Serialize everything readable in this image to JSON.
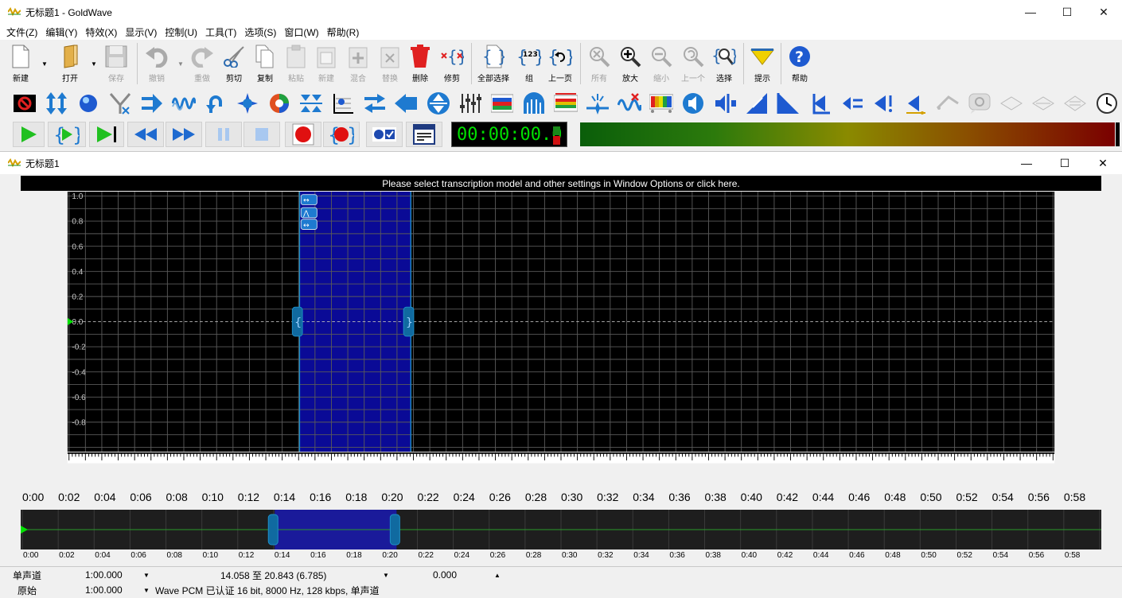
{
  "app": {
    "window_title": "无标题1 - GoldWave",
    "controls": {
      "minimize": "—",
      "maximize": "☐",
      "close": "✕"
    }
  },
  "menu": [
    "文件(Z)",
    "编辑(Y)",
    "特效(X)",
    "显示(V)",
    "控制(U)",
    "工具(T)",
    "选项(S)",
    "窗口(W)",
    "帮助(R)"
  ],
  "toolbar": {
    "new": "新建",
    "open": "打开",
    "save": "保存",
    "undo": "撤销",
    "redo": "重做",
    "cut": "剪切",
    "copy": "复制",
    "paste": "粘贴",
    "paste_new": "新建",
    "mix": "混合",
    "replace": "替换",
    "delete": "删除",
    "trim": "修剪",
    "select_all": "全部选择",
    "group": "组",
    "prev_page": "上一页",
    "all": "所有",
    "zoom_in": "放大",
    "zoom_out": "缩小",
    "previous": "上一个",
    "select": "选择",
    "cue": "提示",
    "help": "帮助"
  },
  "transport": {
    "time": "00:00:00.0"
  },
  "document": {
    "title": "无标题1",
    "banner": "Please select transcription model and other settings in Window Options or click here.",
    "y_labels": [
      "1.0",
      "0.8",
      "0.6",
      "0.4",
      "0.2",
      "0.0",
      "-0.2",
      "-0.4",
      "-0.6",
      "-0.8"
    ],
    "time_labels": [
      "0:00",
      "0:02",
      "0:04",
      "0:06",
      "0:08",
      "0:10",
      "0:12",
      "0:14",
      "0:16",
      "0:18",
      "0:20",
      "0:22",
      "0:24",
      "0:26",
      "0:28",
      "0:30",
      "0:32",
      "0:34",
      "0:36",
      "0:38",
      "0:40",
      "0:42",
      "0:44",
      "0:46",
      "0:48",
      "0:50",
      "0:52",
      "0:54",
      "0:56",
      "0:58"
    ],
    "selection": {
      "start_seconds": 14.058,
      "end_seconds": 20.843,
      "total_seconds": 60
    }
  },
  "status": {
    "row1": {
      "channel": "单声道",
      "zoom": "1:00.000",
      "selection": "14.058 至 20.843 (6.785)",
      "position": "0.000"
    },
    "row2": {
      "label": "原始",
      "length": "1:00.000",
      "format": "Wave PCM 已认证 16 bit, 8000 Hz, 128 kbps, 单声道"
    }
  },
  "colors": {
    "selection": "#0a0a96",
    "grid": "#5a5a5a",
    "waveform_bg": "#000000",
    "marker": "#1e90c8",
    "time_text": "#00e000"
  }
}
